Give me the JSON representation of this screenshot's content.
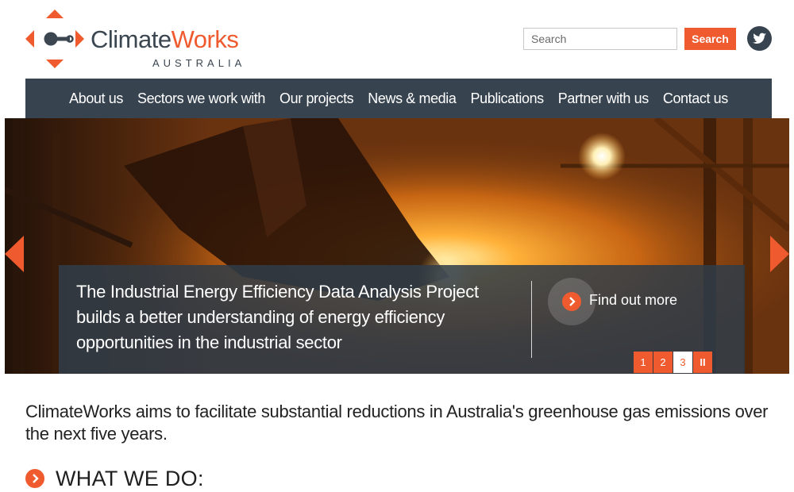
{
  "brand": {
    "name_part1": "Climate",
    "name_part2": "Works",
    "subtitle": "AUSTRALIA",
    "accent_color": "#ef5a2f",
    "dark_color": "#37434f"
  },
  "header": {
    "search_placeholder": "Search",
    "search_button": "Search",
    "social_icon": "twitter-icon"
  },
  "nav": {
    "items": [
      {
        "label": "About us"
      },
      {
        "label": "Sectors we work with"
      },
      {
        "label": "Our projects"
      },
      {
        "label": "News & media"
      },
      {
        "label": "Publications"
      },
      {
        "label": "Partner with us"
      },
      {
        "label": "Contact us"
      }
    ]
  },
  "hero": {
    "caption": "The Industrial Energy Efficiency Data Analysis Project builds a better understanding of energy efficiency opportunities in the industrial sector",
    "cta_label": "Find out more",
    "prev_icon": "chevron-left-icon",
    "next_icon": "chevron-right-icon",
    "pager": {
      "pages": [
        "1",
        "2",
        "3"
      ],
      "active_page": "3",
      "pause_label": "II"
    }
  },
  "main": {
    "intro": "ClimateWorks aims to facilitate substantial reductions in Australia's greenhouse gas emissions over the next five years.",
    "section_title": "WHAT WE DO:"
  }
}
